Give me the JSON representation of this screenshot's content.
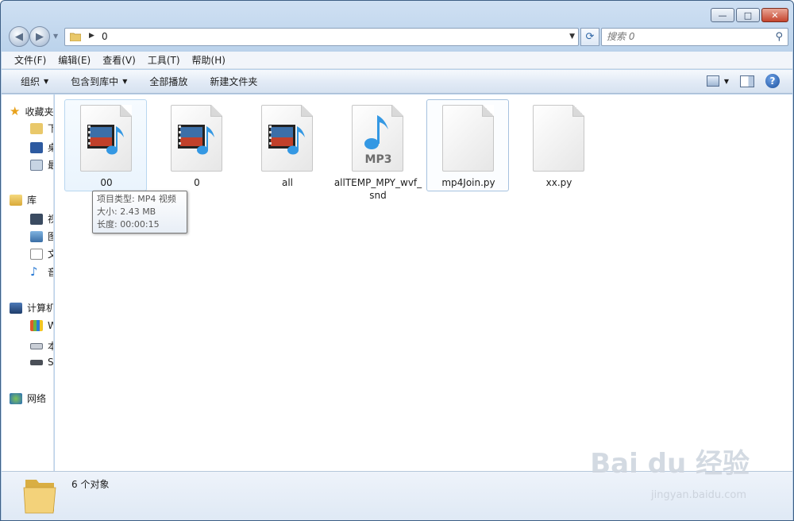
{
  "window": {
    "minimize_glyph": "—",
    "maximize_glyph": "□",
    "close_glyph": "✕"
  },
  "address": {
    "breadcrumb": "0",
    "search_placeholder": "搜索 0"
  },
  "menu": [
    "文件(F)",
    "编辑(E)",
    "查看(V)",
    "工具(T)",
    "帮助(H)"
  ],
  "toolbar": {
    "organize": "组织",
    "include_in_library": "包含到库中",
    "play_all": "全部播放",
    "new_folder": "新建文件夹",
    "help": "?"
  },
  "nav_pane": {
    "favorites": "收藏夹",
    "downloads": "下载",
    "desktop": "桌面",
    "recent": "最近访问的位置",
    "libraries": "库",
    "videos": "视频",
    "pictures": "图片",
    "documents": "文档",
    "music": "音乐",
    "computer": "计算机",
    "drive_c": "W",
    "drive_d": "本",
    "drive_e": "S",
    "network": "网络"
  },
  "files": [
    {
      "name": "00",
      "icon": "video-file-icon",
      "state": "hover"
    },
    {
      "name": "0",
      "icon": "video-file-icon",
      "state": "normal"
    },
    {
      "name": "all",
      "icon": "video-file-icon",
      "state": "normal"
    },
    {
      "name": "allTEMP_MPY_wvf_snd",
      "icon": "mp3-file-icon",
      "state": "normal"
    },
    {
      "name": "mp4Join.py",
      "icon": "blank-file-icon",
      "state": "selected"
    },
    {
      "name": "xx.py",
      "icon": "blank-file-icon",
      "state": "normal"
    }
  ],
  "tooltip": {
    "type": "项目类型: MP4 视频",
    "size": "大小: 2.43 MB",
    "length": "长度: 00:00:15"
  },
  "details": {
    "count": "6 个对象"
  },
  "watermark": {
    "main": "Bai du 经验",
    "sub": "jingyan.baidu.com"
  },
  "colors": {
    "accent": "#1b4f9c",
    "selection_border": "#a6c2df",
    "hover_fill": "#eaf4fd"
  }
}
